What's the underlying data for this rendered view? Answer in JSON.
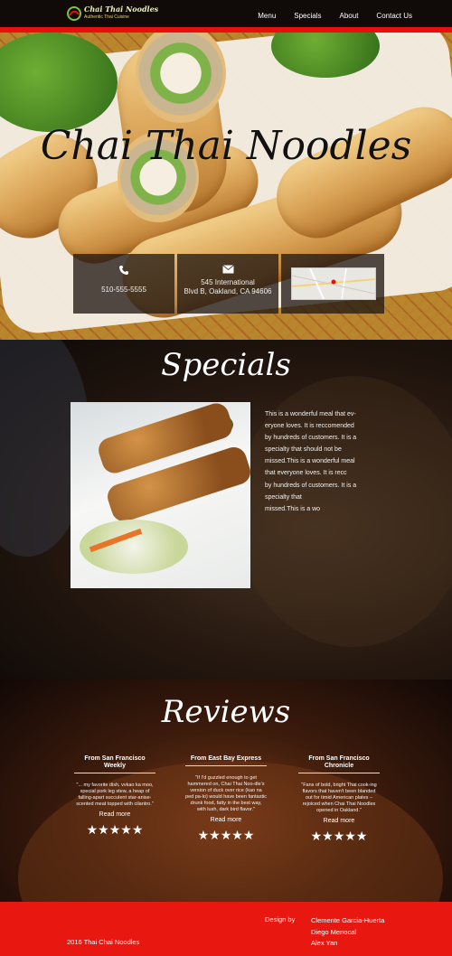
{
  "header": {
    "logo_title": "Chai Thai Noodles",
    "logo_subtitle": "Authentic Thai Cuisine",
    "nav": [
      "Menu",
      "Specials",
      "About",
      "Contact Us"
    ]
  },
  "hero": {
    "title": "Chai Thai Noodles",
    "phone": "510-555-5555",
    "address_line1": "545 International",
    "address_line2": "Blvd B, Oakland, CA 94606"
  },
  "specials": {
    "title": "Specials",
    "text_lines": [
      "This is a wonderful meal that ev-",
      "eryone loves. It is reccomended",
      "by hundreds of customers. It is a",
      "specialty that should not be",
      "missed.This is a wonderful meal",
      "that everyone loves. It is recc",
      "by hundreds of customers. It is a",
      "specialty that",
      "missed.This is a wo"
    ]
  },
  "reviews": {
    "title": "Reviews",
    "items": [
      {
        "source": "From San Francisco Weekly",
        "quote": "\"... my favorite dish,   vvkao ka moo, special pork leg stew, a heap of falling-apart succulent star-anise-scented meat topped with cilantro.\"",
        "more": "Read more",
        "stars": "★★★★★"
      },
      {
        "source": "From East Bay Express",
        "quote": "\"If I'd guzzled enough to get hammered on, Chai Thai Noo-dle's version of duck over rice (kao na ped pa-lo) would have been fantastic drunk food, fatty in the best way, with lush, dark bird flavor.\"",
        "more": "Read more",
        "stars": "★★★★★"
      },
      {
        "source": "From San Francisco Chronicle",
        "quote": "\"Fans of bold, bright Thai cook-ing flavors that haven't been blanded out for timid American plates – rejoiced when Chai Thai Noodles opened in Oakland.\"",
        "more": "Read more",
        "stars": "★★★★★"
      }
    ]
  },
  "footer": {
    "copyright": "2016 Thai Chai Noodles",
    "design_label": "Design by",
    "designers": [
      "Clemente Garcia-Huerta",
      "Diego Menocal",
      "Alex Yan"
    ]
  },
  "colors": {
    "accent_red": "#e8100c",
    "info_box": "#231914"
  },
  "icons": [
    "phone-icon",
    "envelope-icon",
    "map-icon",
    "star-icon"
  ]
}
